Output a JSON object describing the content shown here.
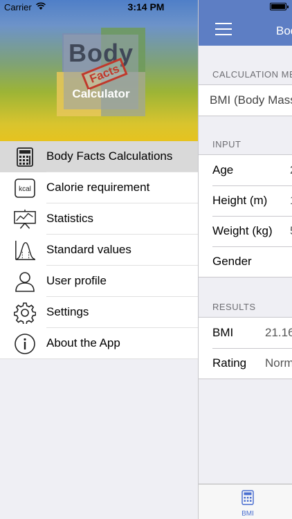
{
  "status_bar": {
    "carrier": "Carrier",
    "time": "3:14 PM"
  },
  "logo": {
    "word_top": "Body",
    "word_stamp": "Facts",
    "word_bottom": "Calculator"
  },
  "menu": {
    "items": [
      {
        "label": "Body Facts Calculations",
        "icon": "calculator-icon",
        "selected": true
      },
      {
        "label": "Calorie requirement",
        "icon": "kcal-icon"
      },
      {
        "label": "Statistics",
        "icon": "chart-board-icon"
      },
      {
        "label": "Standard values",
        "icon": "bell-curve-icon"
      },
      {
        "label": "User profile",
        "icon": "user-icon"
      },
      {
        "label": "Settings",
        "icon": "gear-icon"
      },
      {
        "label": "About the App",
        "icon": "info-icon"
      }
    ]
  },
  "detail": {
    "nav_title": "Bod",
    "calc_method_header": "CALCULATION MET",
    "calc_method_value": "BMI (Body Mass",
    "input_header": "INPUT",
    "inputs": [
      {
        "label": "Age",
        "value": "2"
      },
      {
        "label": "Height (m)",
        "value": "1"
      },
      {
        "label": "Weight (kg)",
        "value": "5"
      },
      {
        "label": "Gender",
        "value": ""
      }
    ],
    "results_header": "RESULTS",
    "results": [
      {
        "label": "BMI",
        "value": "21.16"
      },
      {
        "label": "Rating",
        "value": "Norm"
      }
    ],
    "tab_label": "BMI"
  },
  "colors": {
    "nav_blue": "#5d7ec4",
    "tab_tint": "#4a6fd0",
    "selected_row": "#d9d9d9"
  }
}
